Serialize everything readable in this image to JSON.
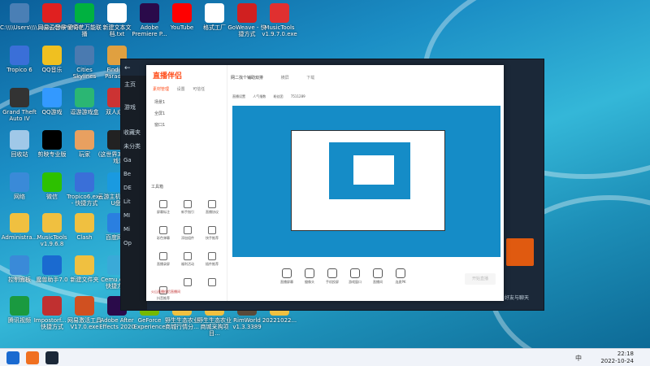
{
  "desktop": {
    "icons": [
      {
        "label": "C:\\\\\\\\Users\\\\\\\\...\\\\\\\\COMPUTER",
        "color": "#4a7fb5",
        "icon": "computer-icon"
      },
      {
        "label": "网易云音乐",
        "color": "#e02020",
        "icon": "netease-music-icon"
      },
      {
        "label": "爱奇艺万能联播",
        "color": "#00b140",
        "icon": "iqiyi-icon"
      },
      {
        "label": "新建文本文档.txt",
        "color": "#ffffff",
        "icon": "text-file-icon"
      },
      {
        "label": "Adobe Premiere P...",
        "color": "#2a0a4a",
        "icon": "premiere-icon"
      },
      {
        "label": "YouTube",
        "color": "#ff0000",
        "icon": "youtube-icon"
      },
      {
        "label": "格式工厂",
        "color": "#ffffff",
        "icon": "format-factory-icon"
      },
      {
        "label": "GoWeave - 快捷方式",
        "color": "#d02020",
        "icon": "goweave-icon"
      },
      {
        "label": "MusicTools v1.9.7.0.exe",
        "color": "#e03030",
        "icon": "musictools-icon"
      },
      {
        "label": "Tropico 6",
        "color": "#3a6fd8",
        "icon": "tropico-icon"
      },
      {
        "label": "QQ音乐",
        "color": "#f0c020",
        "icon": "qq-music-icon"
      },
      {
        "label": "Cities Skylines",
        "color": "#4a7ab0",
        "icon": "cities-icon"
      },
      {
        "label": "Finding Paradise",
        "color": "#e0a040",
        "icon": "finding-paradise-icon"
      },
      {
        "label": "Grand Theft Auto IV",
        "color": "#333333",
        "icon": "gta-icon"
      },
      {
        "label": "QQ游戏",
        "color": "#3399ff",
        "icon": "qq-game-icon"
      },
      {
        "label": "逗游游戏盒",
        "color": "#2bb673",
        "icon": "game-box-icon"
      },
      {
        "label": "双人成行",
        "color": "#cc3333",
        "icon": "it-takes-two-icon"
      },
      {
        "label": "回收站",
        "color": "#a0c8e8",
        "icon": "recycle-bin-icon"
      },
      {
        "label": "剪映专业版",
        "color": "#000000",
        "icon": "capcut-icon"
      },
      {
        "label": "玩家",
        "color": "#e8a060",
        "icon": "player-icon"
      },
      {
        "label": "(这世界3DM游戏)",
        "color": "#222222",
        "icon": "3dm-icon"
      },
      {
        "label": "网络",
        "color": "#3a8ad8",
        "icon": "network-icon"
      },
      {
        "label": "微信",
        "color": "#2dc100",
        "icon": "wechat-icon"
      },
      {
        "label": "Tropico6.exe - 快捷方式",
        "color": "#3a6fd8",
        "icon": "tropico-exe-icon"
      },
      {
        "label": "云游主机 (可以U盘)",
        "color": "#1a9ae0",
        "icon": "cloud-host-icon"
      },
      {
        "label": "Administra...",
        "color": "#f0c040",
        "icon": "admin-folder-icon"
      },
      {
        "label": "MusicTools v1.9.6.8",
        "color": "#f0c040",
        "icon": "musictools-folder-icon"
      },
      {
        "label": "Clash",
        "color": "#f0c040",
        "icon": "clash-folder-icon"
      },
      {
        "label": "百度网盘",
        "color": "#2a7fe0",
        "icon": "baidu-disk-icon"
      },
      {
        "label": "控制面板",
        "color": "#3a8ad8",
        "icon": "control-panel-icon"
      },
      {
        "label": "魔兽助手7.0",
        "color": "#1a6ad0",
        "icon": "wow-helper-icon"
      },
      {
        "label": "新建文件夹",
        "color": "#f0c040",
        "icon": "new-folder-icon"
      },
      {
        "label": "Cemu.exe - 快捷方式",
        "color": "#3aaad8",
        "icon": "cemu-icon"
      },
      {
        "label": "腾讯视频",
        "color": "#1a9a40",
        "icon": "tencent-video-icon"
      },
      {
        "label": "Impostorf... - 快捷方式",
        "color": "#c03030",
        "icon": "impostor-icon"
      },
      {
        "label": "网易激活工具V17.0.exe",
        "color": "#d05020",
        "icon": "activator-icon"
      },
      {
        "label": "Adobe After Effects 2020",
        "color": "#2a0a4a",
        "icon": "after-effects-icon"
      },
      {
        "label": "GeForce Experience",
        "color": "#76b900",
        "icon": "geforce-icon"
      },
      {
        "label": "野生生态农业商城行情分...",
        "color": "#f0c040",
        "icon": "eco-folder-1-icon"
      },
      {
        "label": "野生生态农业商城采购项目...",
        "color": "#f0c040",
        "icon": "eco-folder-2-icon"
      },
      {
        "label": "RimWorld v1.3.3389",
        "color": "#5a4a3a",
        "icon": "rimworld-icon"
      },
      {
        "label": "20221022...",
        "color": "#f0c040",
        "icon": "date-folder-icon"
      }
    ]
  },
  "steam": {
    "nav_back": "←",
    "nav_home": "主页",
    "nav_games": "游戏",
    "sidebar_items": [
      "收藏夹",
      "未分类",
      "Ga",
      "Be",
      "DE",
      "Lit",
      "MI",
      "Mi",
      "Op"
    ],
    "right_label": "好友与聊天"
  },
  "live_app": {
    "logo_text": "直播伴侣",
    "tabs": [
      "素材管理",
      "设置",
      "可信任"
    ],
    "scenes": [
      "场景1",
      "全屏1",
      "窗口1"
    ],
    "tools_title": "工具箱",
    "tools": [
      "屏幕标注",
      "新手指引",
      "直播协议",
      "彩色弹幕",
      "添加组件",
      "快手推荐",
      "直播录屏",
      "福利活动",
      "插件推荐",
      "抖音推荐",
      "",
      ""
    ],
    "footer_note": "火山直播伴侣直播间",
    "top_title": "网二找个铺助双排",
    "top_menu": [
      "横屏",
      "下载"
    ],
    "subbar": [
      "直播设置",
      "人气指数",
      "粉丝团",
      "7511289"
    ],
    "bottom_buttons": [
      "直播屏幕",
      "摄像头",
      "手机投屏",
      "游戏窗口",
      "直播间",
      "连麦PK"
    ],
    "go_live": "开始直播"
  },
  "taskbar": {
    "time": "22:18",
    "date": "2022-10-24",
    "tray_lang": "中",
    "icons": [
      {
        "name": "windows-start-icon",
        "color": "#1a6ad0"
      },
      {
        "name": "live-companion-taskbar-icon",
        "color": "#f07020"
      },
      {
        "name": "steam-taskbar-icon",
        "color": "#1b2838"
      }
    ]
  }
}
